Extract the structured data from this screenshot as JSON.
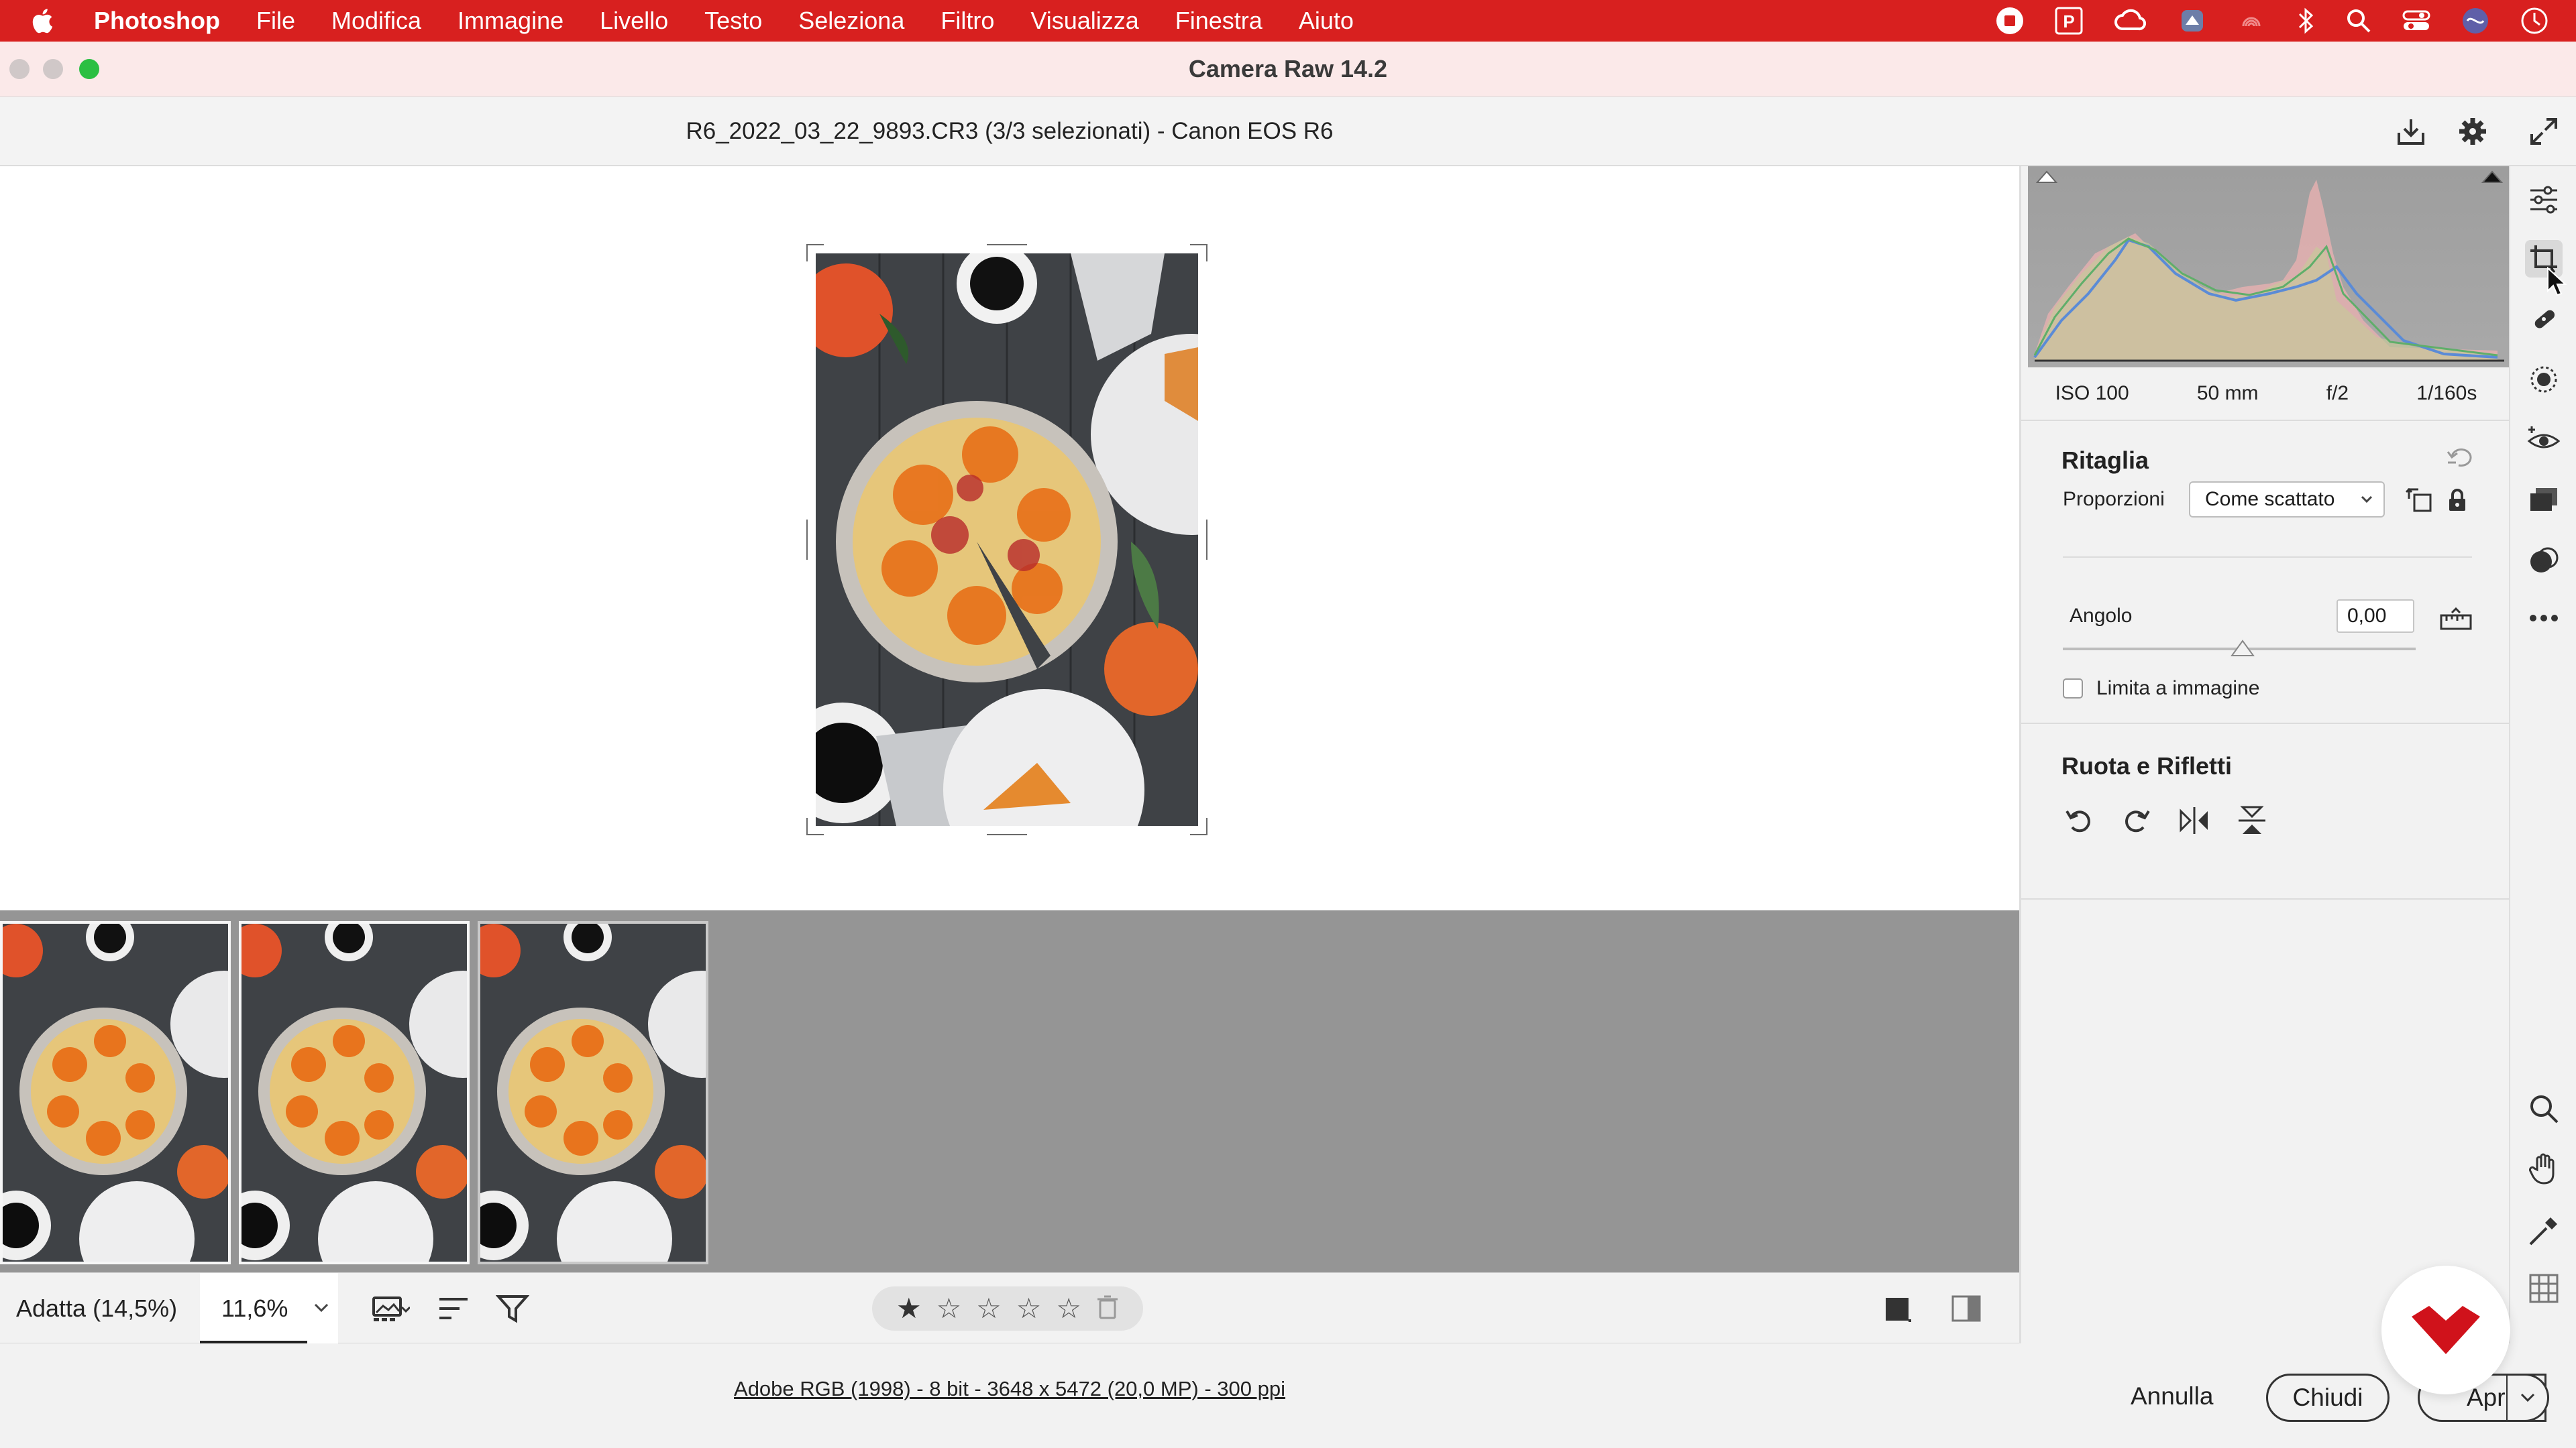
{
  "menubar": {
    "app": "Photoshop",
    "items": [
      "File",
      "Modifica",
      "Immagine",
      "Livello",
      "Testo",
      "Seleziona",
      "Filtro",
      "Visualizza",
      "Finestra",
      "Aiuto"
    ]
  },
  "window": {
    "title": "Camera Raw 14.2"
  },
  "file": {
    "header": "R6_2022_03_22_9893.CR3 (3/3 selezionati)  -  Canon EOS R6"
  },
  "exif": {
    "iso": "ISO 100",
    "focal": "50 mm",
    "aperture": "f/2",
    "shutter": "1/160s"
  },
  "crop": {
    "title": "Ritaglia",
    "aspect_label": "Proporzioni",
    "aspect_value": "Come scattato",
    "angle_label": "Angolo",
    "angle_value": "0,00",
    "constrain_label": "Limita a immagine",
    "constrain_checked": false
  },
  "rotate": {
    "title": "Ruota e Rifletti"
  },
  "bottombar": {
    "fit_label": "Adatta (14,5%)",
    "zoom_value": "11,6%",
    "rating": 0
  },
  "status": {
    "info": "Adobe RGB (1998) - 8 bit - 3648 x 5472 (20,0 MP) - 300 ppi",
    "cancel": "Annulla",
    "close": "Chiudi",
    "open": "Apri"
  },
  "filmstrip": {
    "count": 3,
    "selected": 3
  },
  "colors": {
    "menubar": "#d8201f",
    "titlebar": "#fbe9e9",
    "filmstrip_bg": "#959595",
    "brand": "#d0121b"
  }
}
